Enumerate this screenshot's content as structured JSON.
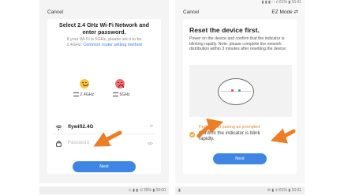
{
  "left_screen": {
    "cancel_label": "Cancel",
    "title": "Select 2.4 GHz Wi-Fi Network and enter password.",
    "description": "If your Wi-Fi is 5GHz, please set it to be 2.4GHz.",
    "link": "Common router setting method",
    "band_good": "2.4GHz",
    "band_bad": "5GHz",
    "wifi_name": "flywifi2.4G",
    "wifi_switch": "⇄",
    "password_placeholder": "Password",
    "next_label": "Next"
  },
  "right_screen": {
    "status": "▮ ▮ ▮ ⁝ ⁝ ıl 61% ▮ 16:41",
    "cancel_label": "Cancel",
    "mode_label": "EZ Mode ⇄",
    "title": "Reset the device first.",
    "description": "Power on the device and confirm that the indicator is blinking rapidly. Note: please complete the network distribution within 3 minutes after resetting the device.",
    "pair_link": "Perform net pairing as prompted",
    "confirm_text": "Confirm the indicator is blink rapidly.",
    "next_label": "Next"
  },
  "bottom": {
    "left_status": "⚠ ▮ ▮ ⁝ıl 39% ▮ 09:00",
    "right_status_left": "▮",
    "right_status_right": "✉ ▮ ⁝ıl 61% ▮ 16:41"
  },
  "colors": {
    "accent": "#3f86e4",
    "arrow": "#ee7d23"
  }
}
